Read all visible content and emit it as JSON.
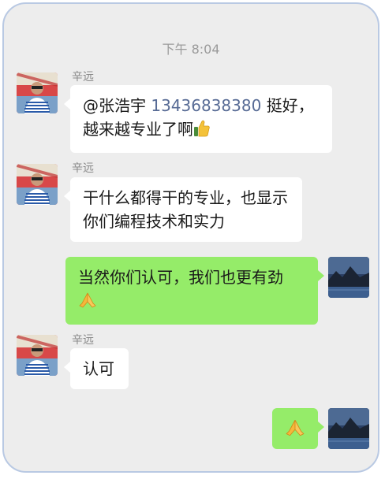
{
  "timestamp": "下午 8:04",
  "messages": [
    {
      "sender": "辛远",
      "direction": "in",
      "mention": "@张浩宇",
      "phone": "13436838380",
      "text_after_phone": " 挺好，",
      "line2": "越来越专业了啊",
      "emoji": "thumbs-up-icon"
    },
    {
      "sender": "辛远",
      "direction": "in",
      "line1": "干什么都得干的专业，也显示",
      "line2": "你们编程技术和实力"
    },
    {
      "sender": "self",
      "direction": "out",
      "line1": "当然你们认可，我们也更有劲",
      "emoji": "pray-hands-icon"
    },
    {
      "sender": "辛远",
      "direction": "in",
      "line1": "认可"
    },
    {
      "sender": "self",
      "direction": "out",
      "emoji": "pray-hands-icon"
    }
  ],
  "colors": {
    "background": "#ededed",
    "incoming_bubble": "#ffffff",
    "outgoing_bubble": "#95ec69",
    "link": "#576b95",
    "frame_border": "#b9c9e3"
  }
}
